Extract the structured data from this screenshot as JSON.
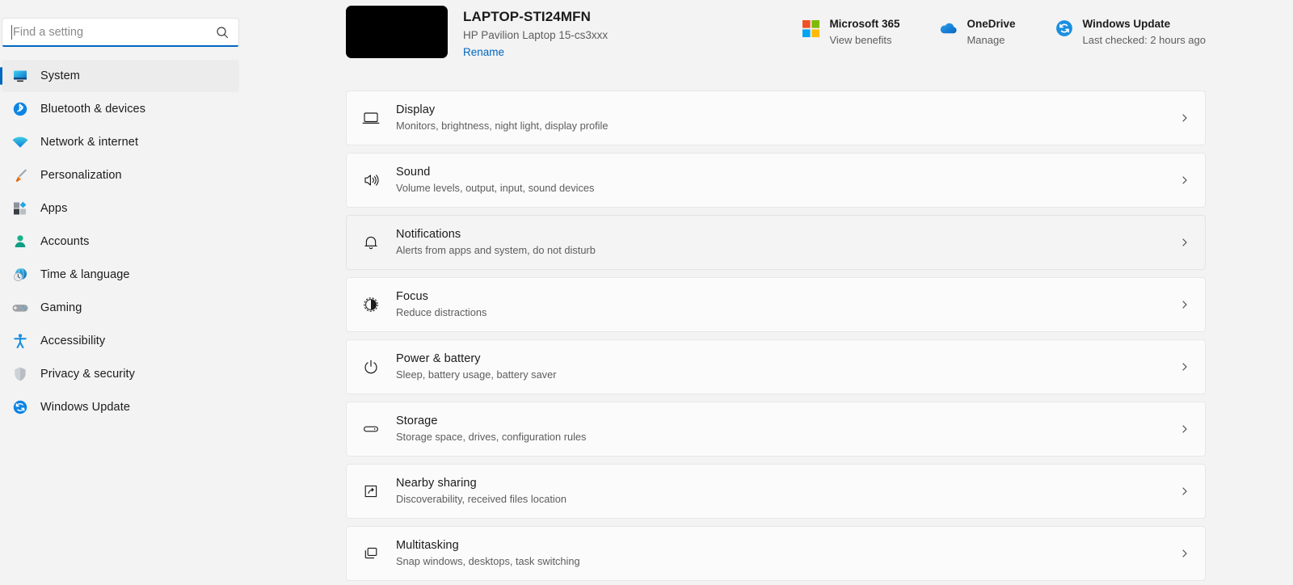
{
  "search": {
    "placeholder": "Find a setting",
    "value": "",
    "icon": "search-icon"
  },
  "sidebar": {
    "items": [
      {
        "label": "System",
        "icon": "monitor-icon",
        "selected": true
      },
      {
        "label": "Bluetooth & devices",
        "icon": "bluetooth-icon",
        "selected": false
      },
      {
        "label": "Network & internet",
        "icon": "wifi-icon",
        "selected": false
      },
      {
        "label": "Personalization",
        "icon": "paintbrush-icon",
        "selected": false
      },
      {
        "label": "Apps",
        "icon": "apps-icon",
        "selected": false
      },
      {
        "label": "Accounts",
        "icon": "person-icon",
        "selected": false
      },
      {
        "label": "Time & language",
        "icon": "clock-globe-icon",
        "selected": false
      },
      {
        "label": "Gaming",
        "icon": "gamepad-icon",
        "selected": false
      },
      {
        "label": "Accessibility",
        "icon": "accessibility-icon",
        "selected": false
      },
      {
        "label": "Privacy & security",
        "icon": "shield-icon",
        "selected": false
      },
      {
        "label": "Windows Update",
        "icon": "sync-icon",
        "selected": false
      }
    ]
  },
  "header": {
    "device_name": "LAPTOP-STI24MFN",
    "device_model": "HP Pavilion Laptop 15-cs3xxx",
    "rename_label": "Rename",
    "device_image": "black-device-thumbnail",
    "status_cards": [
      {
        "title": "Microsoft 365",
        "subtitle": "View benefits",
        "icon": "microsoft-logo-icon"
      },
      {
        "title": "OneDrive",
        "subtitle": "Manage",
        "icon": "onedrive-cloud-icon"
      },
      {
        "title": "Windows Update",
        "subtitle": "Last checked: 2 hours ago",
        "icon": "sync-icon"
      }
    ]
  },
  "main": {
    "settings": [
      {
        "title": "Display",
        "desc": "Monitors, brightness, night light, display profile",
        "icon": "monitor-outline-icon",
        "hover": false
      },
      {
        "title": "Sound",
        "desc": "Volume levels, output, input, sound devices",
        "icon": "speaker-icon",
        "hover": false
      },
      {
        "title": "Notifications",
        "desc": "Alerts from apps and system, do not disturb",
        "icon": "bell-icon",
        "hover": true
      },
      {
        "title": "Focus",
        "desc": "Reduce distractions",
        "icon": "focus-icon",
        "hover": false
      },
      {
        "title": "Power & battery",
        "desc": "Sleep, battery usage, battery saver",
        "icon": "power-icon",
        "hover": false
      },
      {
        "title": "Storage",
        "desc": "Storage space, drives, configuration rules",
        "icon": "storage-icon",
        "hover": false
      },
      {
        "title": "Nearby sharing",
        "desc": "Discoverability, received files location",
        "icon": "nearby-sharing-icon",
        "hover": false
      },
      {
        "title": "Multitasking",
        "desc": "Snap windows, desktops, task switching",
        "icon": "multitasking-icon",
        "hover": false
      }
    ],
    "chevron_icon": "chevron-right-icon"
  },
  "colors": {
    "accent": "#0067c0",
    "background": "#f3f3f3",
    "card": "#fbfbfb",
    "card_hover": "#f4f4f4",
    "link": "#0067c0",
    "text_primary": "#1b1b1b",
    "text_secondary": "#5d5d5d"
  }
}
